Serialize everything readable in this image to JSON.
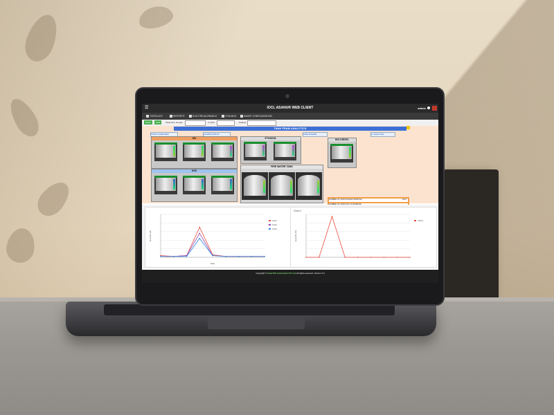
{
  "app": {
    "window_title": "IOCL ASANUR WEB CLIENT",
    "user_label": "admin"
  },
  "tabs": [
    {
      "label": "TOPOLOGY"
    },
    {
      "label": "REPORTS"
    },
    {
      "label": "ELECTRICAL/PANELS"
    },
    {
      "label": "TOOLBOX"
    },
    {
      "label": "SMART CONFIGURATION"
    }
  ],
  "filter": {
    "btn1": "Show",
    "btn2": "Hide",
    "label1": "Parameter Groups",
    "label2": "In Hold",
    "label3": "Dataset"
  },
  "dashboard": {
    "title": "TANK FRAM ANALYTICS",
    "subtabs": [
      "PUMP OVERVIEW",
      "ALARM STATUS",
      "FIRE ENGINE",
      "LL ANALYSIS"
    ],
    "groups": [
      {
        "label": "MS"
      },
      {
        "label": "HSD"
      },
      {
        "label": "ETHANOL"
      },
      {
        "label": "BIO DIESEL"
      },
      {
        "label": "FIRE WATER TANK"
      }
    ],
    "stats": [
      {
        "label": "NUMBER OF TANKS RADAR WORKING",
        "value": "11/16"
      },
      {
        "label": "NUMBER OF TANKS ATG IS WORKING",
        "value": ""
      },
      {
        "label": "NUMBER OF TANKS ABOVE HIGH WORKING",
        "value": ""
      },
      {
        "label": "NUMBER OF TANKS LVL DIFFERENCE IN SECONDARY",
        "value": "4"
      },
      {
        "label": "NUMBER OF DYKE VALVE OPEN",
        "value": ""
      }
    ]
  },
  "colors": {
    "accent_blue": "#3d6fd6",
    "tank_header_green": "#1a8f2e",
    "stats_orange": "#f39c4a",
    "dashboard_bg": "#fbe3cf"
  },
  "footer": {
    "prefix": "Copyright ©",
    "brand": "SmartOS Automation Pvt Ltd",
    "suffix": "All rights reserved. Version 2.0"
  },
  "chart_data": [
    {
      "type": "line",
      "title": "",
      "xlabel": "Date",
      "ylabel": "Quantity (kl)",
      "series": [
        {
          "name": "Tank1",
          "values": [
            2,
            1,
            2,
            35,
            3,
            1,
            1,
            1,
            1
          ]
        },
        {
          "name": "Tank2",
          "values": [
            1,
            1,
            2,
            28,
            2,
            1,
            1,
            1,
            1
          ]
        },
        {
          "name": "Tank3",
          "values": [
            1,
            1,
            1,
            22,
            2,
            1,
            1,
            1,
            1
          ]
        }
      ],
      "ylim": [
        0,
        50
      ],
      "grid": true,
      "legend": "right"
    },
    {
      "type": "line",
      "title": "Chart 1",
      "xlabel": "",
      "ylabel": "Quantity (%)",
      "series": [
        {
          "name": "TANK1",
          "values": [
            0,
            0,
            95,
            0,
            0,
            0,
            0,
            0,
            0
          ]
        }
      ],
      "ylim": [
        0,
        100
      ],
      "grid": true,
      "legend": "right"
    }
  ]
}
